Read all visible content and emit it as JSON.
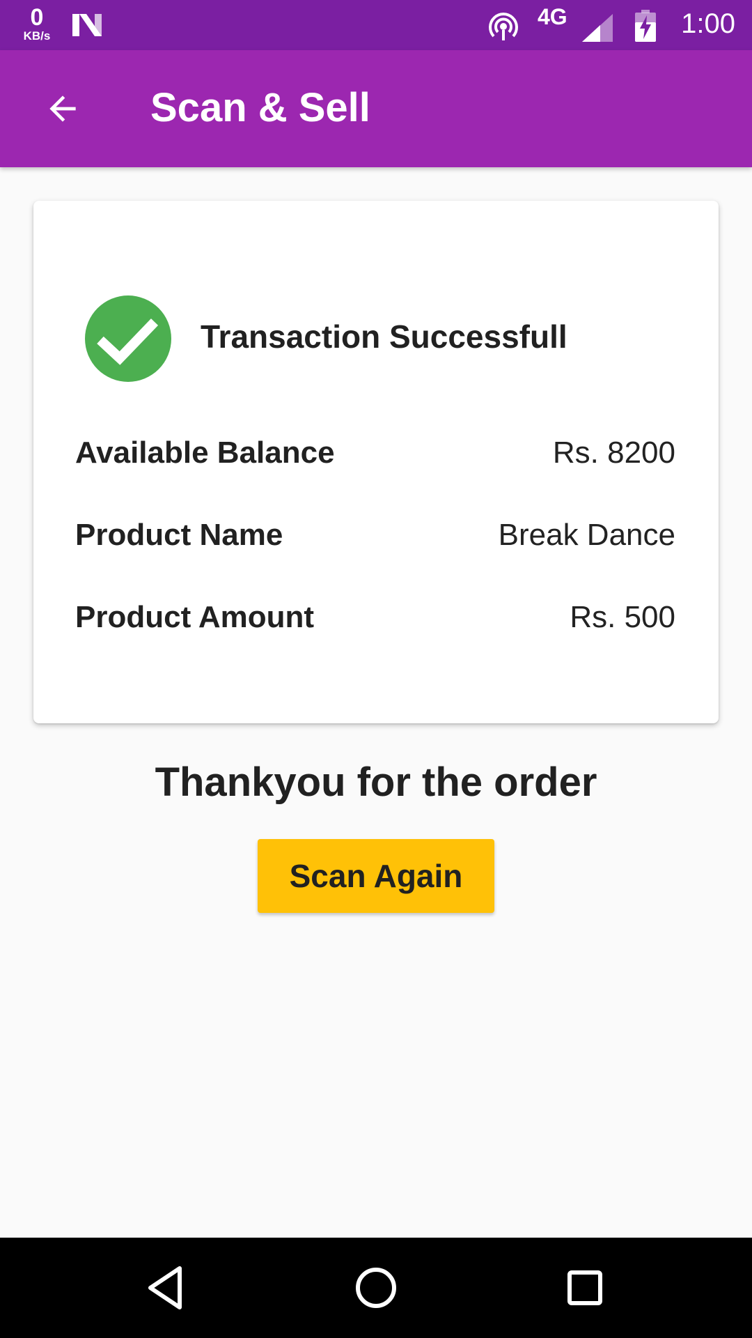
{
  "status_bar": {
    "net_speed_value": "0",
    "net_speed_unit": "KB/s",
    "network_type": "4G",
    "time": "1:00",
    "icons": [
      "n-icon",
      "hotspot-icon",
      "signal-icon",
      "battery-charging-icon"
    ]
  },
  "app_bar": {
    "title": "Scan & Sell",
    "back_icon": "arrow-back-icon",
    "color": "#9c27b0"
  },
  "transaction": {
    "status_text": "Transaction Successfull",
    "status_icon": "check-circle-icon",
    "status_color": "#4caf50",
    "rows": [
      {
        "label": "Available Balance",
        "value": "Rs. 8200"
      },
      {
        "label": "Product Name",
        "value": "Break Dance"
      },
      {
        "label": "Product Amount",
        "value": "Rs. 500"
      }
    ]
  },
  "message": "Thankyou for the order",
  "actions": {
    "scan_again_label": "Scan Again",
    "button_color": "#ffc107"
  },
  "nav_bar": {
    "buttons": [
      "nav-back-icon",
      "nav-home-icon",
      "nav-recents-icon"
    ]
  }
}
